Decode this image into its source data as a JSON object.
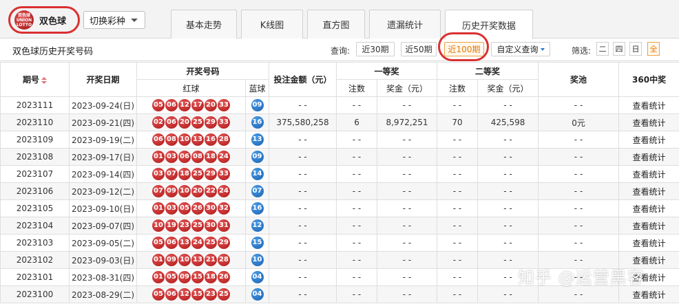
{
  "header": {
    "logo_text": "双色球 UNION LOTTO",
    "brand": "双色球",
    "switch_label": "切换彩种",
    "tabs": [
      {
        "label": "基本走势",
        "active": false
      },
      {
        "label": "K线图",
        "active": false
      },
      {
        "label": "直方图",
        "active": false
      },
      {
        "label": "遗漏统计",
        "active": false
      },
      {
        "label": "历史开奖数据",
        "active": true
      }
    ]
  },
  "toolbar": {
    "title": "双色球历史开奖号码",
    "query_label": "查询:",
    "query_buttons": [
      {
        "label": "近30期",
        "active": false
      },
      {
        "label": "近50期",
        "active": false
      },
      {
        "label": "近100期",
        "active": true
      }
    ],
    "custom_query": "自定义查询",
    "filter_label": "筛选:",
    "filters": [
      {
        "label": "二",
        "active": false
      },
      {
        "label": "四",
        "active": false
      },
      {
        "label": "日",
        "active": false
      },
      {
        "label": "全",
        "active": true
      }
    ]
  },
  "table": {
    "headers": {
      "issue": "期号",
      "date": "开奖日期",
      "numbers": "开奖号码",
      "red": "红球",
      "blue": "蓝球",
      "bet_amount": "投注金额（元）",
      "first_prize": "一等奖",
      "second_prize": "二等奖",
      "count": "注数",
      "prize": "奖金（元）",
      "pool": "奖池",
      "stats": "360中奖"
    },
    "rows": [
      {
        "issue": "2023111",
        "date": "2023-09-24(日)",
        "red": [
          "05",
          "06",
          "12",
          "17",
          "20",
          "33"
        ],
        "blue": "09",
        "bet": "- -",
        "c1": "- -",
        "p1": "- -",
        "c2": "- -",
        "p2": "- -",
        "pool": "- -",
        "link": "查看统计"
      },
      {
        "issue": "2023110",
        "date": "2023-09-21(四)",
        "red": [
          "02",
          "06",
          "20",
          "25",
          "29",
          "33"
        ],
        "blue": "16",
        "bet": "375,580,258",
        "c1": "6",
        "p1": "8,972,251",
        "c2": "70",
        "p2": "425,598",
        "pool": "0元",
        "link": "查看统计"
      },
      {
        "issue": "2023109",
        "date": "2023-09-19(二)",
        "red": [
          "06",
          "08",
          "10",
          "13",
          "16",
          "28"
        ],
        "blue": "13",
        "bet": "- -",
        "c1": "- -",
        "p1": "- -",
        "c2": "- -",
        "p2": "- -",
        "pool": "- -",
        "link": "查看统计"
      },
      {
        "issue": "2023108",
        "date": "2023-09-17(日)",
        "red": [
          "01",
          "03",
          "06",
          "08",
          "18",
          "24"
        ],
        "blue": "09",
        "bet": "- -",
        "c1": "- -",
        "p1": "- -",
        "c2": "- -",
        "p2": "- -",
        "pool": "- -",
        "link": "查看统计"
      },
      {
        "issue": "2023107",
        "date": "2023-09-14(四)",
        "red": [
          "03",
          "07",
          "18",
          "25",
          "29",
          "33"
        ],
        "blue": "14",
        "bet": "- -",
        "c1": "- -",
        "p1": "- -",
        "c2": "- -",
        "p2": "- -",
        "pool": "- -",
        "link": "查看统计"
      },
      {
        "issue": "2023106",
        "date": "2023-09-12(二)",
        "red": [
          "07",
          "09",
          "10",
          "20",
          "22",
          "24"
        ],
        "blue": "07",
        "bet": "- -",
        "c1": "- -",
        "p1": "- -",
        "c2": "- -",
        "p2": "- -",
        "pool": "- -",
        "link": "查看统计"
      },
      {
        "issue": "2023105",
        "date": "2023-09-10(日)",
        "red": [
          "01",
          "03",
          "05",
          "26",
          "30",
          "32"
        ],
        "blue": "16",
        "bet": "- -",
        "c1": "- -",
        "p1": "- -",
        "c2": "- -",
        "p2": "- -",
        "pool": "- -",
        "link": "查看统计"
      },
      {
        "issue": "2023104",
        "date": "2023-09-07(四)",
        "red": [
          "10",
          "19",
          "23",
          "25",
          "30",
          "31"
        ],
        "blue": "12",
        "bet": "- -",
        "c1": "- -",
        "p1": "- -",
        "c2": "- -",
        "p2": "- -",
        "pool": "- -",
        "link": "查看统计"
      },
      {
        "issue": "2023103",
        "date": "2023-09-05(二)",
        "red": [
          "05",
          "06",
          "13",
          "24",
          "25",
          "29"
        ],
        "blue": "15",
        "bet": "- -",
        "c1": "- -",
        "p1": "- -",
        "c2": "- -",
        "p2": "- -",
        "pool": "- -",
        "link": "查看统计"
      },
      {
        "issue": "2023102",
        "date": "2023-09-03(日)",
        "red": [
          "01",
          "09",
          "10",
          "13",
          "21",
          "28"
        ],
        "blue": "10",
        "bet": "- -",
        "c1": "- -",
        "p1": "- -",
        "c2": "- -",
        "p2": "- -",
        "pool": "- -",
        "link": "查看统计"
      },
      {
        "issue": "2023101",
        "date": "2023-08-31(四)",
        "red": [
          "01",
          "05",
          "09",
          "15",
          "18",
          "26"
        ],
        "blue": "04",
        "bet": "- -",
        "c1": "- -",
        "p1": "- -",
        "c2": "- -",
        "p2": "- -",
        "pool": "- -",
        "link": "查看统计"
      },
      {
        "issue": "2023100",
        "date": "2023-08-29(二)",
        "red": [
          "05",
          "06",
          "12",
          "15",
          "23",
          "25"
        ],
        "blue": "04",
        "bet": "- -",
        "c1": "- -",
        "p1": "- -",
        "c2": "- -",
        "p2": "- -",
        "pool": "- -",
        "link": "查看统计"
      }
    ]
  },
  "watermark": "知乎 @运营黑客",
  "colors": {
    "red_ball": "#c62222",
    "blue_ball": "#2a7acb",
    "highlight_ring": "#d93030",
    "active_orange": "#e87800"
  }
}
